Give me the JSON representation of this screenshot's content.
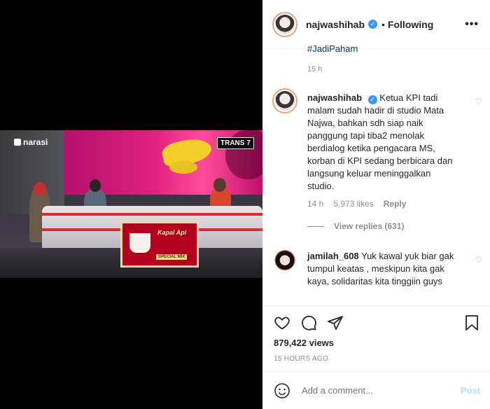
{
  "video": {
    "watermark_left": "narasi",
    "watermark_right": "TRANS 7",
    "panel_brand": "Kapal Api",
    "panel_label": "SPECIAL MIX"
  },
  "post": {
    "author": "najwashihab",
    "follow_status": "Following",
    "separator": "•",
    "hashtag": "#JadiPaham",
    "caption_time": "15 h"
  },
  "comments": [
    {
      "username": "najwashihab",
      "text": "Ketua KPI tadi malam sudah hadir di studio Mata Najwa, bahkan sdh siap naik panggung tapi tiba2 menolak berdialog ketika pengacara MS, korban di KPI sedang berbicara dan langsung keluar meninggalkan studio.",
      "time": "14 h",
      "likes": "5,973 likes",
      "reply_label": "Reply",
      "view_replies": "View replies (631)"
    },
    {
      "username": "jamilah_608",
      "text": "Yuk kawal yuk biar gak tumpul keatas , meskipun kita gak kaya, solidaritas kita tinggiin guys"
    }
  ],
  "stats": {
    "views": "879,422 views",
    "posted": "15 HOURS AGO"
  },
  "composer": {
    "placeholder": "Add a comment...",
    "post_label": "Post"
  },
  "colors": {
    "link": "#00376b",
    "verified": "#3897f0",
    "post_disabled": "#b2dffc",
    "muted": "#8e8e8e"
  },
  "icons": [
    "more-icon",
    "verified-icon",
    "heart-icon",
    "comment-icon",
    "share-icon",
    "bookmark-icon",
    "emoji-icon"
  ]
}
